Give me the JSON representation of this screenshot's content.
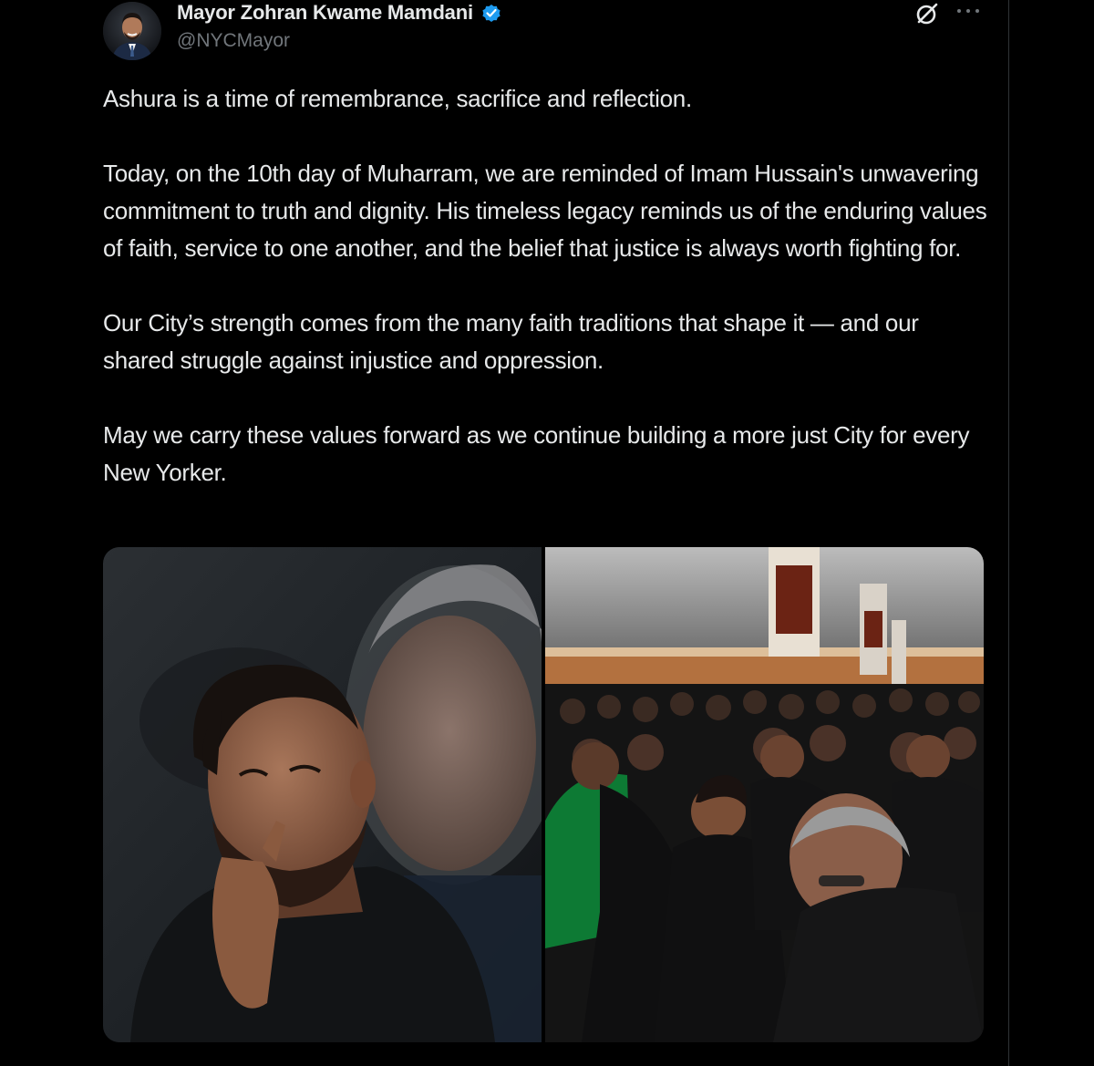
{
  "author": {
    "display_name": "Mayor Zohran Kwame Mamdani",
    "handle": "@NYCMayor",
    "verified": true,
    "verified_color": "#1d9bf0"
  },
  "icons": {
    "verified": "verified-badge-icon",
    "grok": "grok-icon",
    "more": "more-options-icon"
  },
  "tweet": {
    "paragraphs": [
      "Ashura is a time of remembrance, sacrifice and reflection.",
      "Today, on the 10th day of Muharram, we are reminded of Imam Hussain's unwavering commitment to truth and dignity. His timeless legacy reminds us of the enduring values of faith, service to one another, and the belief that justice is always worth fighting for.",
      "Our City’s strength comes from the many faith traditions that shape it — and our shared struggle against injustice and oppression.",
      "May we carry these values forward as we continue building a more just City for every New Yorker."
    ]
  },
  "media": {
    "count": 2,
    "items": [
      "photo",
      "photo"
    ]
  },
  "colors": {
    "background": "#000000",
    "text": "#e7e9ea",
    "secondary_text": "#71767b",
    "divider": "#2f3336"
  }
}
